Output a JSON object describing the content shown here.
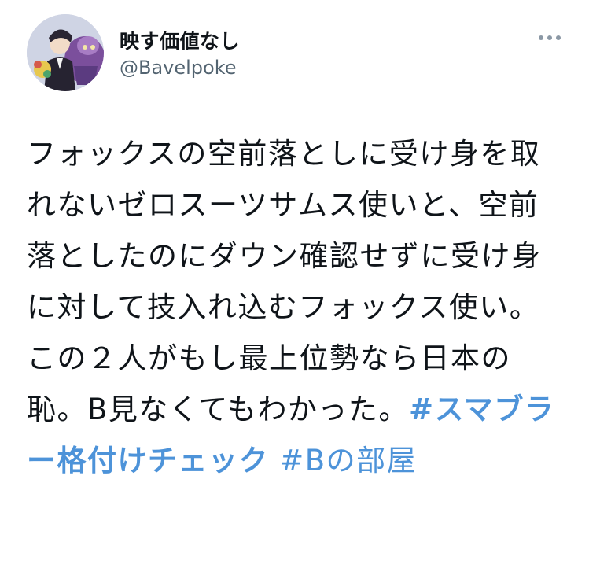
{
  "author": {
    "display_name": "映す価値なし",
    "handle": "@Bavelpoke"
  },
  "tweet": {
    "text": "フォックスの空前落としに受け身を取れないゼロスーツサムス使いと、空前落としたのにダウン確認せずに受け身に対して技入れ込むフォックス使い。この２人がもし最上位勢なら日本の恥。B見なくてもわかった。",
    "hashtags": [
      "#スマブラー格付けチェック",
      "#Bの部屋"
    ]
  },
  "icons": {
    "more": "more-dots-icon",
    "avatar": "avatar-image"
  },
  "colors": {
    "hashtag": "#4d93d9",
    "handle": "#536471",
    "text": "#0f1419"
  }
}
